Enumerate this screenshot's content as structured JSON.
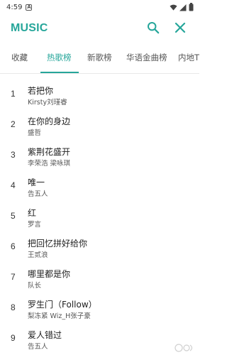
{
  "status_bar": {
    "time": "4:59",
    "info_glyph": "A"
  },
  "header": {
    "title": "MUSIC",
    "accent_color": "#26a69a",
    "icons": [
      "search-icon",
      "close-icon"
    ]
  },
  "tabs": [
    {
      "label": "收藏",
      "active": false
    },
    {
      "label": "热歌榜",
      "active": true
    },
    {
      "label": "新歌榜",
      "active": false
    },
    {
      "label": "华语金曲榜",
      "active": false
    },
    {
      "label": "内地TO",
      "active": false
    }
  ],
  "songs": [
    {
      "rank": "1",
      "title": "若把你",
      "artist": "Kirsty刘瑾睿"
    },
    {
      "rank": "2",
      "title": "在你的身边",
      "artist": "盛哲"
    },
    {
      "rank": "3",
      "title": "紫荆花盛开",
      "artist": "李荣浩  梁咏琪"
    },
    {
      "rank": "4",
      "title": "唯一",
      "artist": "告五人"
    },
    {
      "rank": "5",
      "title": "红",
      "artist": "罗言"
    },
    {
      "rank": "6",
      "title": "把回忆拼好给你",
      "artist": "王贰浪"
    },
    {
      "rank": "7",
      "title": "哪里都是你",
      "artist": "队长"
    },
    {
      "rank": "8",
      "title": "罗生门（Follow）",
      "artist": "梨冻紧  Wiz_H张子豪"
    },
    {
      "rank": "9",
      "title": "爱人错过",
      "artist": "告五人"
    }
  ]
}
